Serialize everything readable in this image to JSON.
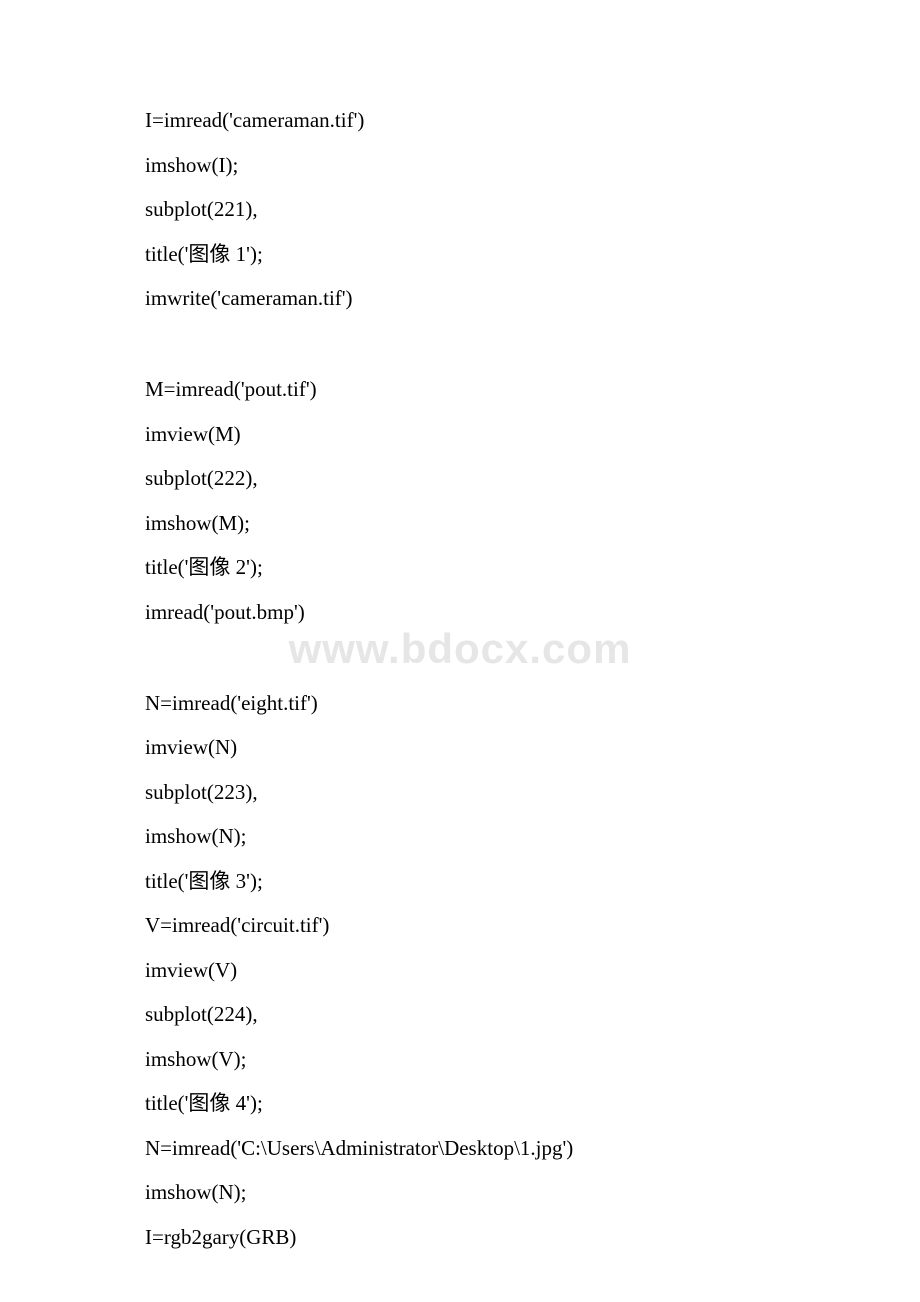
{
  "watermark": "www.bdocx.com",
  "lines": [
    "I=imread('cameraman.tif')",
    "imshow(I);",
    "subplot(221),",
    "title('图像 1');",
    "imwrite('cameraman.tif')",
    "",
    "M=imread('pout.tif')",
    "imview(M)",
    "subplot(222),",
    "imshow(M);",
    "title('图像 2');",
    "imread('pout.bmp')",
    "",
    "N=imread('eight.tif')",
    "imview(N)",
    "subplot(223),",
    "imshow(N);",
    "title('图像 3');",
    "V=imread('circuit.tif')",
    "imview(V)",
    "subplot(224),",
    "imshow(V);",
    "title('图像 4');",
    "N=imread('C:\\Users\\Administrator\\Desktop\\1.jpg')",
    "imshow(N);",
    "I=rgb2gary(GRB)"
  ]
}
